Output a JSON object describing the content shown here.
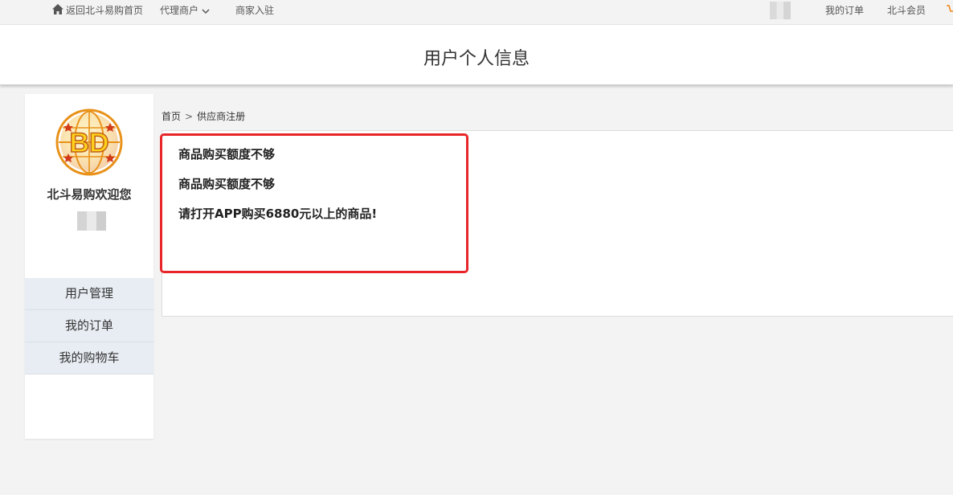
{
  "topbar": {
    "home_label": "返回北斗易购首页",
    "agent_label": "代理商户",
    "merchant_label": "商家入驻",
    "orders_label": "我的订单",
    "member_label": "北斗会员"
  },
  "header": {
    "title": "用户个人信息"
  },
  "sidebar": {
    "logo_text": "BD",
    "welcome": "北斗易购欢迎您",
    "menu": [
      {
        "label": "用户管理"
      },
      {
        "label": "我的订单"
      },
      {
        "label": "我的购物车"
      }
    ]
  },
  "breadcrumb": {
    "home": "首页",
    "separator": ">",
    "current": "供应商注册"
  },
  "messages": [
    "商品购买额度不够",
    "商品购买额度不够",
    "请打开APP购买6880元以上的商品!"
  ],
  "colors": {
    "highlight_border": "#e8262a",
    "menu_bg": "#e8edf3",
    "logo_gold": "#f0a21a"
  }
}
